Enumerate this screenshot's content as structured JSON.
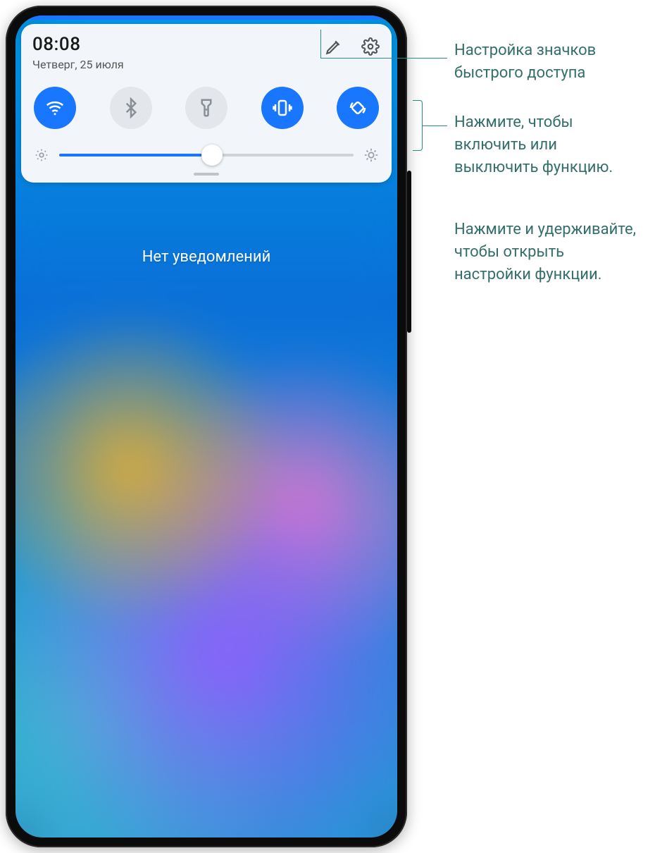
{
  "status": {
    "time": "08:08",
    "date": "Четверг, 25 июля"
  },
  "header_icons": {
    "edit": "edit-icon",
    "settings": "gear-icon"
  },
  "toggles": [
    {
      "name": "wifi",
      "icon": "wifi-icon",
      "active": true
    },
    {
      "name": "bluetooth",
      "icon": "bluetooth-icon",
      "active": false
    },
    {
      "name": "flashlight",
      "icon": "flashlight-icon",
      "active": false
    },
    {
      "name": "vibrate",
      "icon": "vibrate-icon",
      "active": true
    },
    {
      "name": "autorotate",
      "icon": "autorotate-icon",
      "active": true
    }
  ],
  "brightness": {
    "value_percent": 52
  },
  "notifications": {
    "empty_text": "Нет уведомлений"
  },
  "annotations": {
    "edit_hint": "Настройка значков быстрого доступа",
    "toggle_hint_tap": "Нажмите, чтобы включить или выключить функцию.",
    "toggle_hint_hold": "Нажмите и удерживайте, чтобы открыть настройки функции."
  },
  "colors": {
    "accent": "#1976ff",
    "panel_bg": "#f2f6fb",
    "annotation_text": "#346e6a"
  }
}
